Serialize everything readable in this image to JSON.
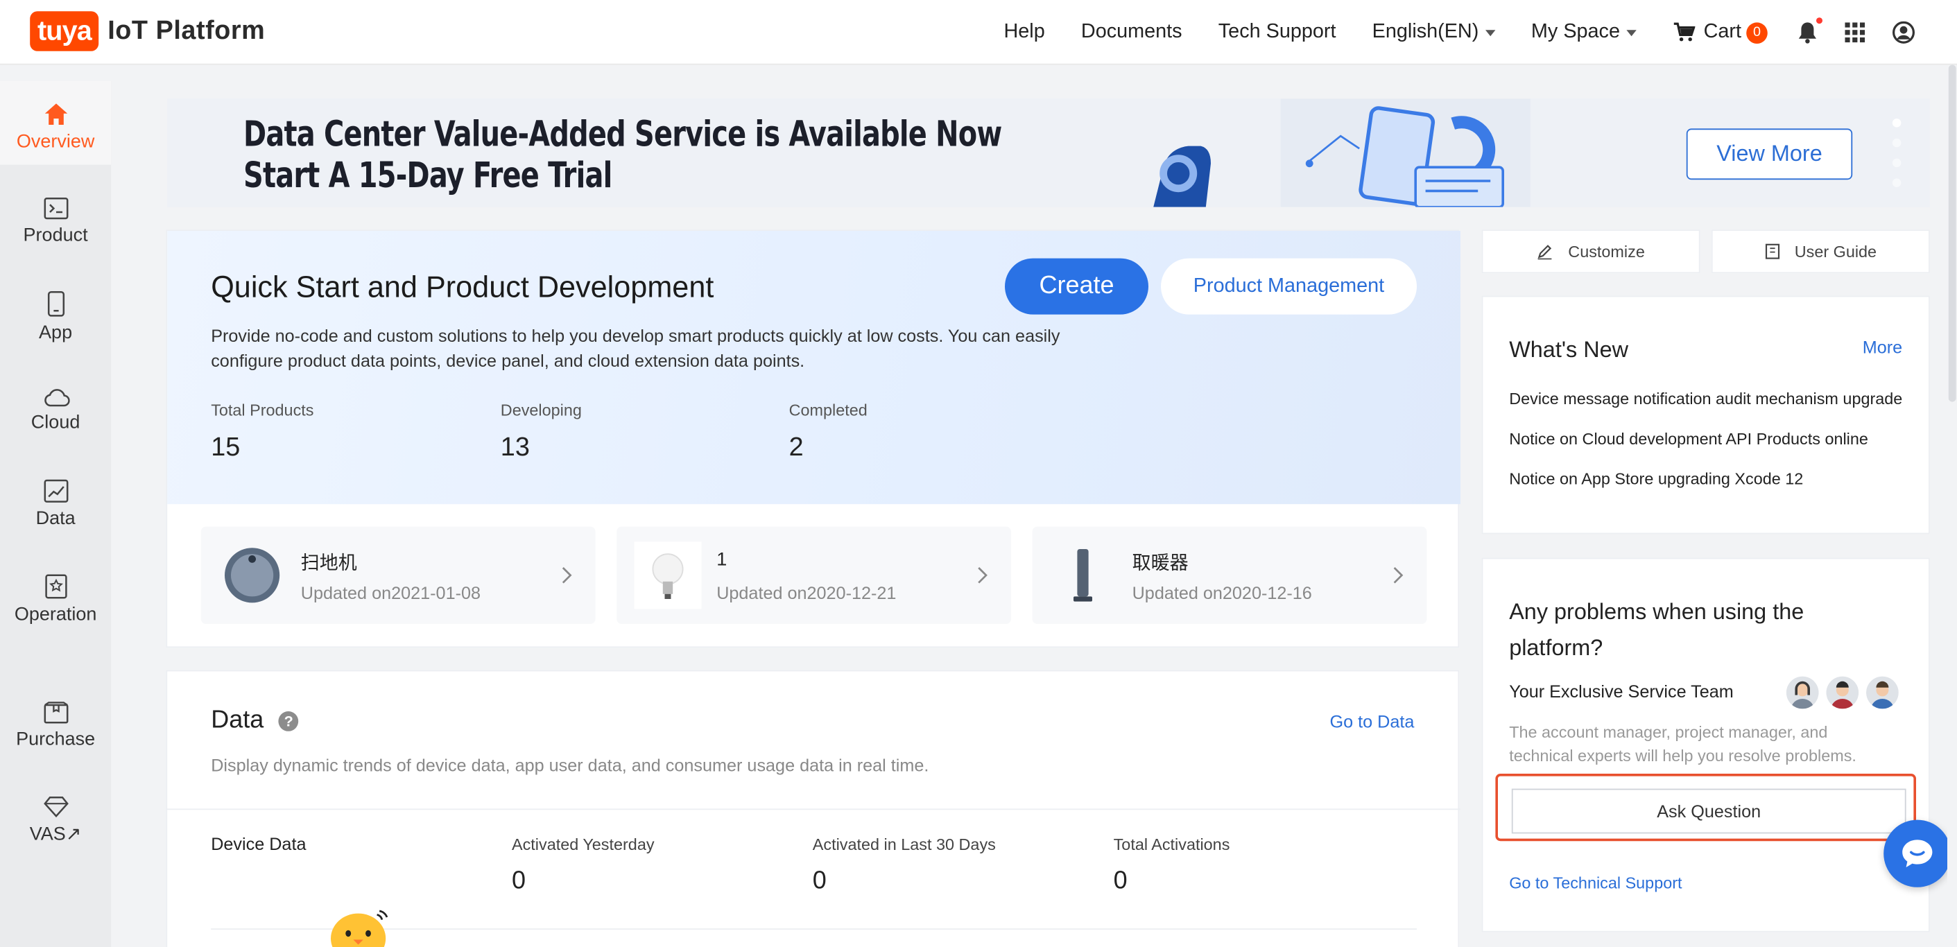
{
  "header": {
    "logo_badge": "tuya",
    "logo_text": "IoT Platform",
    "nav": [
      "Help",
      "Documents",
      "Tech Support"
    ],
    "language": "English(EN)",
    "space": "My Space",
    "cart_label": "Cart",
    "cart_count": "0"
  },
  "sidebar": {
    "items": [
      {
        "label": "Overview",
        "icon": "home-icon"
      },
      {
        "label": "Product",
        "icon": "terminal-icon"
      },
      {
        "label": "App",
        "icon": "phone-icon"
      },
      {
        "label": "Cloud",
        "icon": "cloud-icon"
      },
      {
        "label": "Data",
        "icon": "chart-icon"
      },
      {
        "label": "Operation",
        "icon": "star-doc-icon"
      },
      {
        "label": "Purchase",
        "icon": "box-icon"
      },
      {
        "label": "VAS↗",
        "icon": "diamond-icon"
      }
    ]
  },
  "banner": {
    "line1": "Data Center Value-Added Service is Available Now",
    "line2": "Start A 15-Day Free  Trial",
    "button": "View More"
  },
  "quick_start": {
    "title": "Quick Start and Product Development",
    "description": "Provide no-code and custom solutions to help you develop smart products quickly at low costs. You can easily configure product data points, device panel, and cloud extension data points.",
    "create_button": "Create",
    "manage_button": "Product Management",
    "stats": [
      {
        "label": "Total Products",
        "value": "15"
      },
      {
        "label": "Developing",
        "value": "13"
      },
      {
        "label": "Completed",
        "value": "2"
      }
    ],
    "products": [
      {
        "name": "扫地机",
        "updated": "Updated on2021-01-08"
      },
      {
        "name": "1",
        "updated": "Updated on2020-12-21"
      },
      {
        "name": "取暖器",
        "updated": "Updated on2020-12-16"
      }
    ]
  },
  "data_section": {
    "title": "Data",
    "link": "Go to Data",
    "description": "Display dynamic trends of device data, app user data, and consumer usage data in real time.",
    "device_label": "Device Data",
    "stats": [
      {
        "label": "Activated Yesterday",
        "value": "0"
      },
      {
        "label": "Activated in Last 30 Days",
        "value": "0"
      },
      {
        "label": "Total Activations",
        "value": "0"
      }
    ]
  },
  "right": {
    "customize": "Customize",
    "user_guide": "User Guide",
    "whats_new_title": "What's New",
    "more": "More",
    "news": [
      "Device message notification audit mechanism upgrade",
      "Notice on Cloud development API Products online",
      "Notice on App Store upgrading Xcode 12"
    ],
    "help_title": "Any problems when using the platform?",
    "team_label": "Your Exclusive Service Team",
    "team_desc": "The account manager, project manager, and technical experts will help you resolve problems.",
    "ask_button": "Ask Question",
    "tech_link": "Go to Technical Support"
  },
  "colors": {
    "brand": "#ff4800",
    "accent": "#2a72e5",
    "highlight": "#e8502e"
  }
}
